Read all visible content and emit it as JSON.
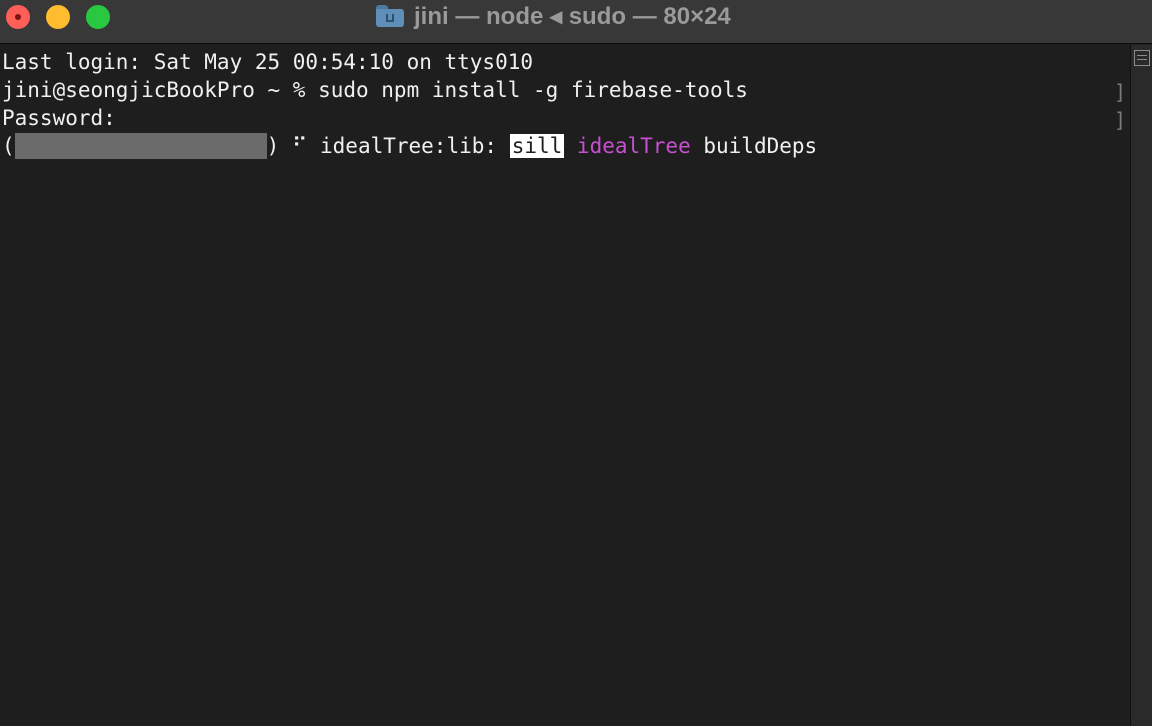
{
  "window": {
    "title": "jini — node ◂ sudo — 80×24",
    "colors": {
      "background": "#1e1e1e",
      "titlebar": "#383838",
      "text": "#f0f0f0",
      "accent_magenta": "#c84fd0",
      "close": "#ff5f57",
      "minimize": "#febc2e",
      "maximize": "#28c840"
    }
  },
  "terminal": {
    "line1": "Last login: Sat May 25 00:54:10 on ttys010",
    "line2": "jini@seongjicBookPro ~ % sudo npm install -g firebase-tools",
    "line3": "Password:",
    "progress": {
      "open_paren": "(",
      "close_paren": ")",
      "spinner": "⠋",
      "stage": "idealTree:lib:",
      "level_badge": "sill",
      "category": "idealTree",
      "message": "buildDeps"
    }
  },
  "icons": {
    "folder": "home-folder-icon",
    "scroll": "scroll-view-icon"
  }
}
